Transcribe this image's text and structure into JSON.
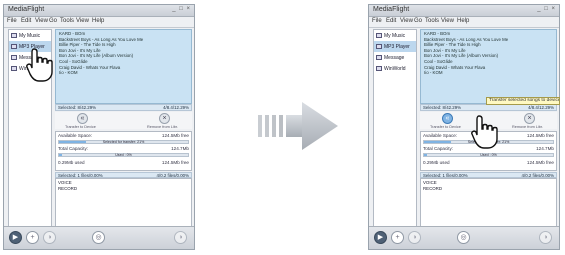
{
  "app": {
    "title": "MediaFlight",
    "window_controls": "_ □ ×"
  },
  "menu": [
    "File",
    "Edit",
    "View",
    "Go",
    "Tools",
    "View",
    "Help"
  ],
  "library": [
    "My Music",
    "MP3 Player",
    "Message",
    "WinWorld"
  ],
  "tracks": [
    "KARD - BOm",
    "Backstreet Boys - As Long As You Love Me",
    "Billie Piper - The Tide Is High",
    "Bon Jovi - It's My Life",
    "Bon Jovi - It's My Life (Album Version)",
    "Cool - SoGlide",
    "Craig David - Whats Your Flava",
    "Iio - KOM"
  ],
  "selection_left": "Selected: 8/42.29%",
  "selection_right": "4/8.4/12.29%",
  "transfer": {
    "to_device_label": "Transfer to Device",
    "remove_label": "Remove from Libr.",
    "to_device_icon": "«",
    "remove_icon": "×"
  },
  "device_info": {
    "available_label": "Available Space:",
    "available_value": "124.5Mb free",
    "selected_caption": "Selected for transfer: 21%",
    "total_label": "Total Capacity:",
    "total_value": "124.7Mb",
    "used_caption": "Used : 0%",
    "used_left": "0.29Mb used",
    "used_right": "124.5Mb free",
    "transfer_fraction": 0.21,
    "used_fraction": 0.02
  },
  "device_selection": {
    "left": "Selected: 1 files/0.00%",
    "right": "4/0.2 files/0.00%"
  },
  "device_folders": [
    "VOICE",
    "RECORD"
  ],
  "tooltip": "Transfer selected songs to device",
  "controls": {
    "play": "▶",
    "add": "+",
    "sync": "◑",
    "center": "◎",
    "right": "◑"
  },
  "colors": {
    "accent": "#7fb3e3",
    "track_bg": "#c9e2f3",
    "highlight": "#bcd7ee"
  }
}
